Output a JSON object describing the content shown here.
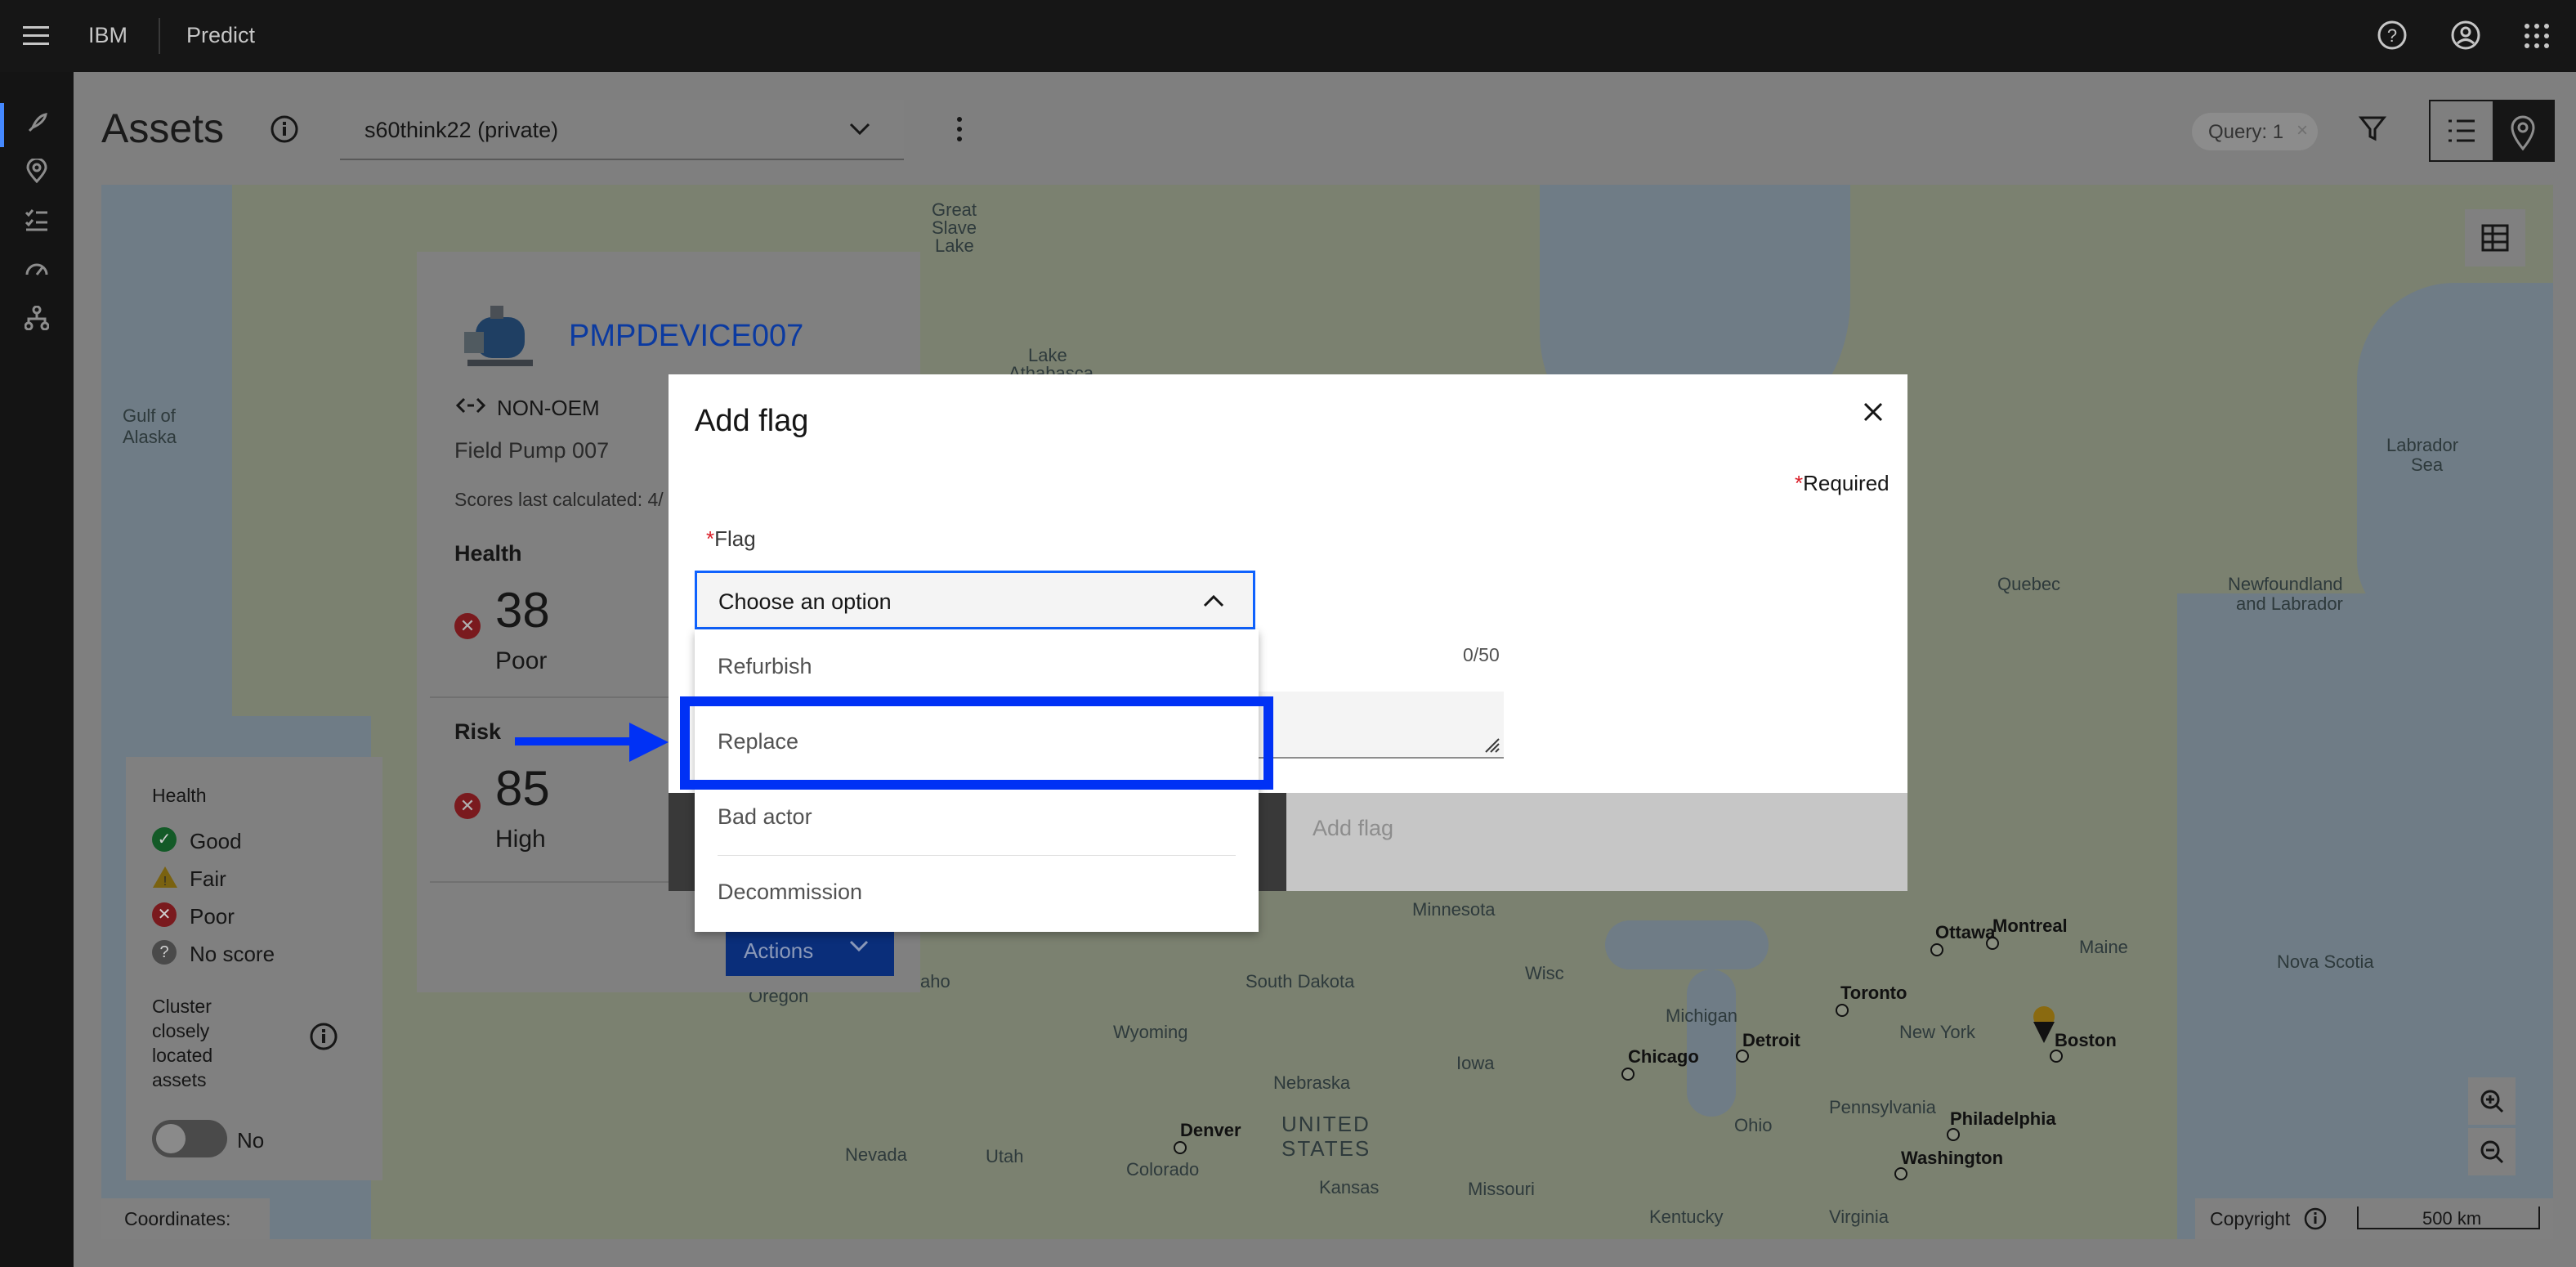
{
  "topbar": {
    "brand": "IBM",
    "product": "Predict"
  },
  "header": {
    "title": "Assets",
    "repository_value": "s60think22 (private)",
    "query_tag": "Query: 1"
  },
  "card": {
    "asset_id": "PMPDEVICE007",
    "manufacturer": "NON-OEM",
    "description": "Field Pump 007",
    "scores_text": "Scores last calculated: 4/",
    "health_label": "Health",
    "health_value": "38",
    "health_status": "Poor",
    "risk_label": "Risk",
    "risk_value": "85",
    "risk_status": "High",
    "actions_label": "Actions"
  },
  "legend": {
    "title": "Health",
    "items": [
      {
        "label": "Good",
        "color": "#24a148"
      },
      {
        "label": "Fair",
        "color": "#f1c21b"
      },
      {
        "label": "Poor",
        "color": "#da1e28"
      },
      {
        "label": "No score",
        "color": "#6f6f6f"
      }
    ],
    "cluster_label": [
      "Cluster",
      "closely",
      "located",
      "assets"
    ],
    "toggle_state": "No"
  },
  "modal": {
    "title": "Add flag",
    "required_marker": "*",
    "required_text": "Required",
    "flag_label_marker": "*",
    "flag_label": "Flag",
    "combo_placeholder": "Choose an option",
    "char_count": "0/50",
    "options": [
      "Refurbish",
      "Replace",
      "Bad actor",
      "Decommission"
    ],
    "submit_label": "Add flag"
  },
  "map": {
    "labels": [
      "Gulf of",
      "Alaska",
      "Great",
      "Slave",
      "Lake",
      "Lake",
      "Athabasca",
      "Labrador",
      "Sea",
      "Quebec",
      "Newfoundland",
      "and Labrador",
      "Nova Scotia",
      "Maine",
      "New York",
      "Michigan",
      "Iowa",
      "Wisc",
      "Minnesota",
      "South Dakota",
      "Wyoming",
      "Nebraska",
      "Nevada",
      "Utah",
      "Colorado",
      "Kansas",
      "Missouri",
      "Ohio",
      "Pennsylvania",
      "Kentucky",
      "Virginia",
      "Oregon",
      "aho",
      "UNITED",
      "STATES"
    ],
    "cities": [
      "Ottawa",
      "Montreal",
      "Toronto",
      "Boston",
      "Chicago",
      "Detroit",
      "Denver",
      "Philadelphia",
      "Washington"
    ]
  },
  "bottombar": {
    "coordinates_label": "Coordinates:",
    "copyright_label": "Copyright",
    "scale": "500 km"
  }
}
